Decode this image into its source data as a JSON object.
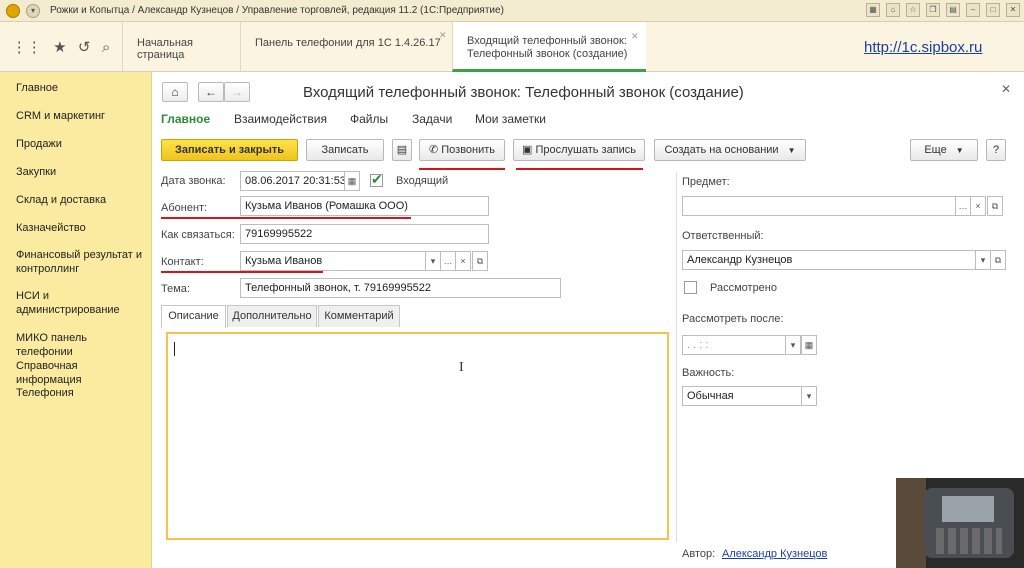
{
  "window": {
    "title": "Рожки и Копытца / Александр Кузнецов / Управление торговлей, редакция 11.2  (1С:Предприятие)"
  },
  "tabs": [
    {
      "label": "Начальная страница"
    },
    {
      "label": "Панель телефонии для 1С 1.4.26.17"
    },
    {
      "label_line1": "Входящий телефонный звонок:",
      "label_line2": "Телефонный звонок (создание)"
    }
  ],
  "site_link": "http://1c.sipbox.ru",
  "sidebar": {
    "items": [
      {
        "label": "Главное"
      },
      {
        "label": "CRM и маркетинг"
      },
      {
        "label": "Продажи"
      },
      {
        "label": "Закупки"
      },
      {
        "label": "Склад и доставка"
      },
      {
        "label": "Казначейство"
      },
      {
        "label": "Финансовый результат и контроллинг"
      },
      {
        "label": "НСИ и администрирование"
      },
      {
        "label": "МИКО панель телефонии"
      },
      {
        "label": "Справочная информация"
      },
      {
        "label": "Телефония"
      }
    ]
  },
  "form": {
    "title": "Входящий телефонный звонок: Телефонный звонок (создание)",
    "sections": [
      {
        "label": "Главное"
      },
      {
        "label": "Взаимодействия"
      },
      {
        "label": "Файлы"
      },
      {
        "label": "Задачи"
      },
      {
        "label": "Мои заметки"
      }
    ],
    "toolbar": {
      "save_close": "Записать и закрыть",
      "save": "Записать",
      "call": "Позвонить",
      "listen": "Прослушать запись",
      "create_based": "Создать на основании",
      "more": "Еще",
      "help": "?"
    },
    "fields": {
      "date_label": "Дата звонка:",
      "date_value": "08.06.2017 20:31:53",
      "incoming_label": "Входящий",
      "subscriber_label": "Абонент:",
      "subscriber_value": "Кузьма Иванов (Ромашка ООО)",
      "contact_how_label": "Как связаться:",
      "contact_how_value": "79169995522",
      "contact_label": "Контакт:",
      "contact_value": "Кузьма Иванов",
      "topic_label": "Тема:",
      "topic_value": "Телефонный звонок, т. 79169995522",
      "subject_label": "Предмет:",
      "subject_value": "",
      "responsible_label": "Ответственный:",
      "responsible_value": "Александр Кузнецов",
      "reviewed_label": "Рассмотрено",
      "review_after_label": "Рассмотреть после:",
      "review_after_value": " .  .       :   :",
      "importance_label": "Важность:",
      "importance_value": "Обычная",
      "author_label": "Автор:",
      "author_value": "Александр Кузнецов"
    },
    "inner_tabs": [
      {
        "label": "Описание"
      },
      {
        "label": "Дополнительно"
      },
      {
        "label": "Комментарий"
      }
    ]
  },
  "colors": {
    "sidebar_bg": "#fbeba0",
    "primary_button": "#f0c419",
    "active_section": "#2e8b3a",
    "underline": "#d01818",
    "link": "#1c3fa6"
  }
}
